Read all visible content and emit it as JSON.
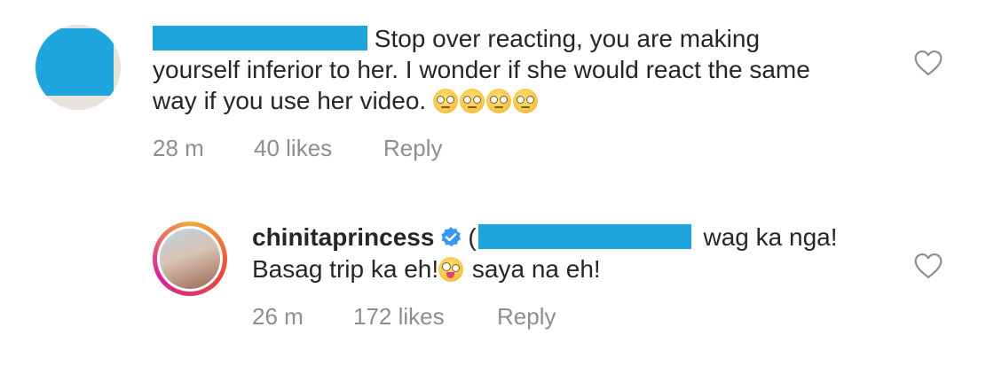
{
  "comments": [
    {
      "text_line1": "Stop over reacting, you are making",
      "text_line2": "yourself inferior to her. I wonder if she would react the same",
      "text_line3": "way if you use her video.",
      "emojis": [
        "face-with-rolling-eyes",
        "face-with-rolling-eyes",
        "face-with-rolling-eyes",
        "face-with-rolling-eyes"
      ],
      "time": "28 m",
      "likes": "40 likes",
      "reply": "Reply"
    },
    {
      "username": "chinitaprincess",
      "verified": true,
      "mention_prefix": "(",
      "text_line1_after": "wag ka nga!",
      "text_line2_a": "Basag trip ka eh!",
      "text_line2_b": " saya na eh!",
      "emoji": "zany-face",
      "time": "26 m",
      "likes": "172 likes",
      "reply": "Reply"
    }
  ],
  "colors": {
    "redaction": "#1ea5dd",
    "verified": "#3897f0",
    "meta": "#8e8e8e",
    "text": "#262626"
  }
}
